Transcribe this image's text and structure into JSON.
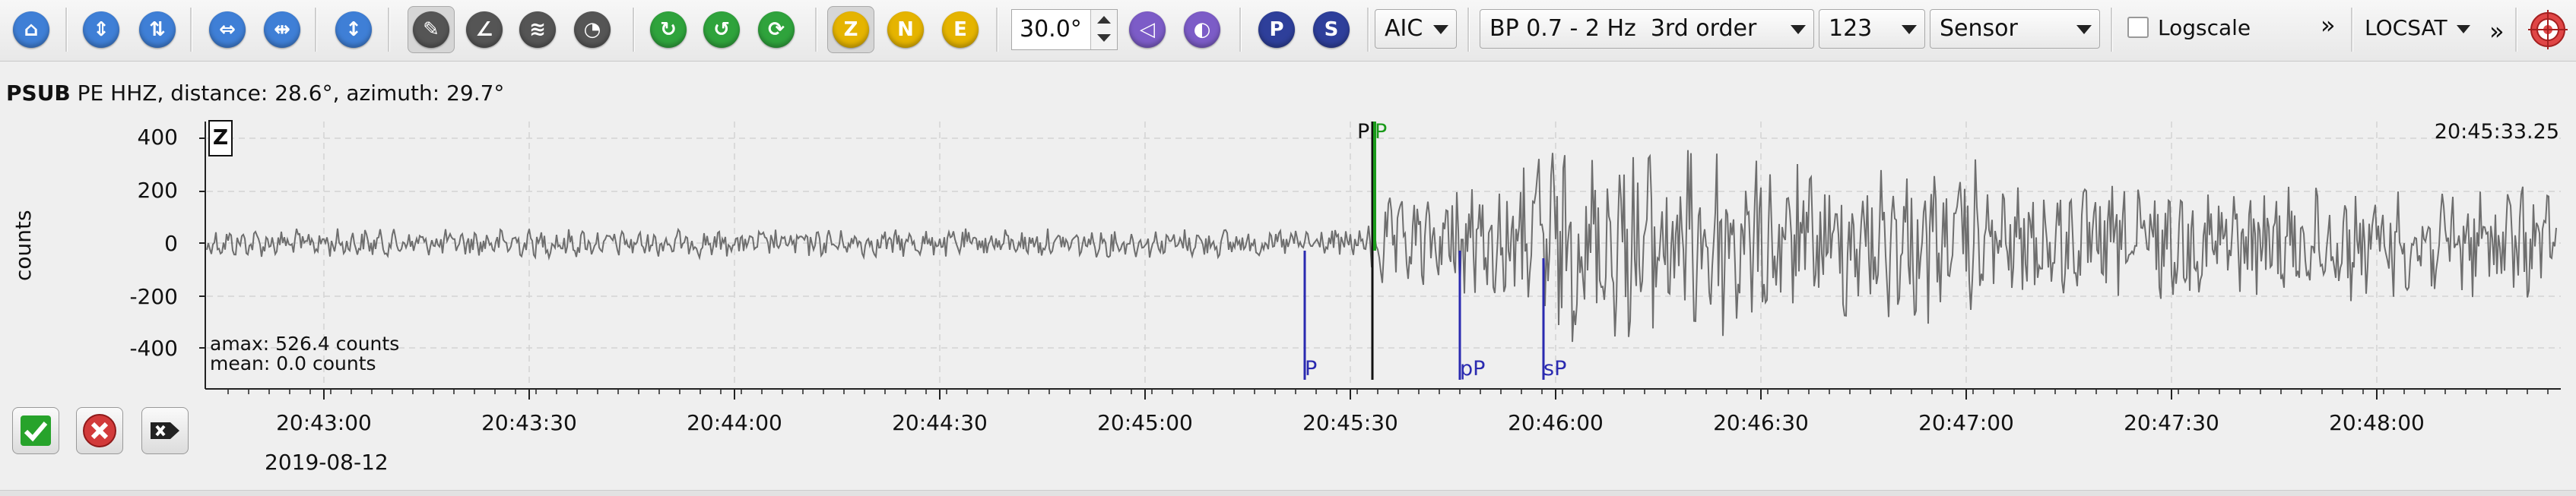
{
  "toolbar": {
    "buttons": [
      {
        "name": "home-icon",
        "glyph": "⌂",
        "color": "#3f7fd6"
      },
      {
        "name": "zoom-in-amplitude-icon",
        "glyph": "⇕",
        "color": "#3f7fd6"
      },
      {
        "name": "zoom-out-amplitude-icon",
        "glyph": "⇅",
        "color": "#3f7fd6"
      },
      {
        "name": "zoom-in-time-icon",
        "glyph": "⇔",
        "color": "#3f7fd6"
      },
      {
        "name": "zoom-out-time-icon",
        "glyph": "⇹",
        "color": "#3f7fd6"
      },
      {
        "name": "scale-reset-icon",
        "glyph": "↕",
        "color": "#3f7fd6"
      },
      {
        "name": "pick-tool-icon",
        "glyph": "✎",
        "color": "#444"
      },
      {
        "name": "measure-angle-icon",
        "glyph": "∠",
        "color": "#444"
      },
      {
        "name": "filter-settings-icon",
        "glyph": "≋",
        "color": "#444"
      },
      {
        "name": "spectrum-icon",
        "glyph": "◔",
        "color": "#444"
      },
      {
        "name": "waveform-align-icon",
        "glyph": "↻",
        "color": "#2fa33c"
      },
      {
        "name": "waveform-realign-icon",
        "glyph": "↺",
        "color": "#2fa33c"
      },
      {
        "name": "waveform-sort-icon",
        "glyph": "⟳",
        "color": "#2fa33c"
      },
      {
        "name": "component-z-icon",
        "glyph": "Z",
        "color": "#e5b400"
      },
      {
        "name": "component-n-icon",
        "glyph": "N",
        "color": "#e5b400"
      },
      {
        "name": "component-e-icon",
        "glyph": "E",
        "color": "#e5b400"
      },
      {
        "name": "rotate-left-icon",
        "glyph": "◁",
        "color": "#7c5cc7"
      },
      {
        "name": "rotate-right-icon",
        "glyph": "◐",
        "color": "#7c5cc7"
      },
      {
        "name": "p-phase-icon",
        "glyph": "P",
        "color": "#2e3f9a"
      },
      {
        "name": "s-phase-icon",
        "glyph": "S",
        "color": "#2e3f9a"
      }
    ],
    "angle_value": "30.0°",
    "picker_method": "AIC",
    "filter": "BP 0.7 - 2 Hz  3rd order",
    "components": "123",
    "units": "Sensor",
    "logscale_label": "Logscale",
    "more_glyph": "»",
    "locator": "LOCSAT",
    "locator_more_glyph": "»",
    "target_icon": "target-icon"
  },
  "trace": {
    "station": "PSUB",
    "info": "PE  HHZ, distance: 28.6°, azimuth: 29.7°",
    "component": "Z",
    "time_label": "20:45:33.25",
    "ylabel": "counts",
    "yticks": [
      "400",
      "200",
      "0",
      "-200",
      "-400"
    ],
    "amax": "amax: 526.4 counts",
    "mean": "mean: 0.0 counts",
    "xticks": [
      "20:43:00",
      "20:43:30",
      "20:44:00",
      "20:44:30",
      "20:45:00",
      "20:45:30",
      "20:46:00",
      "20:46:30",
      "20:47:00",
      "20:47:30",
      "20:48:00"
    ],
    "date": "2019-08-12"
  },
  "picks": {
    "manual_p": "P",
    "auto_p": "P",
    "theo_p": "P",
    "theo_pp": "pP",
    "theo_sp": "sP"
  },
  "actions": {
    "accept": "accept-icon",
    "reject": "reject-icon",
    "apply": "apply-icon"
  },
  "colors": {
    "trace": "#6e6e6e",
    "manual_pick": "#111111",
    "automatic_pick": "#1a9a1a",
    "theoretical_pick": "#2a2ab0"
  }
}
